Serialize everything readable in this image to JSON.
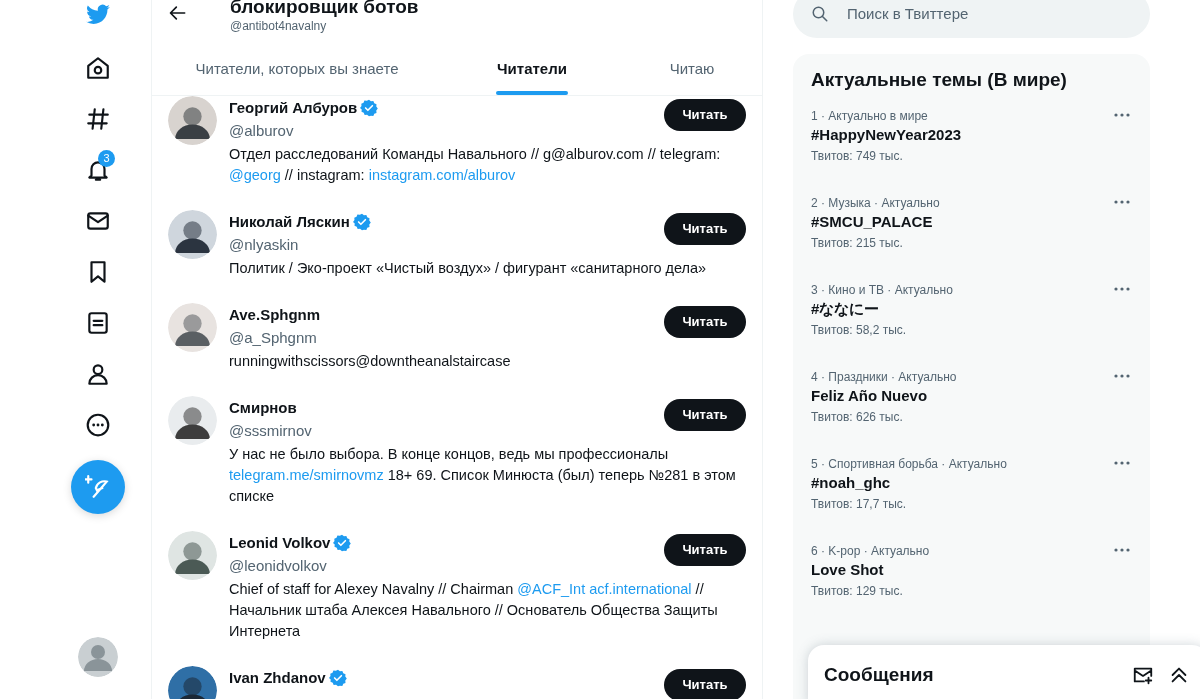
{
  "nav": {
    "notifications_badge": "3"
  },
  "profile": {
    "title": "блокировщик ботов",
    "handle": "@antibot4navalny"
  },
  "tabs": [
    {
      "label": "Читатели, которых вы знаете",
      "selected": false
    },
    {
      "label": "Читатели",
      "selected": true
    },
    {
      "label": "Читаю",
      "selected": false
    }
  ],
  "users": [
    {
      "name": "Георгий Албуров",
      "verified": true,
      "handle": "@alburov",
      "button": "Читать",
      "bio": [
        {
          "kind": "text",
          "text": "Отдел расследований Команды Навального // g@alburov.com // telegram: "
        },
        {
          "kind": "link",
          "text": "@georg"
        },
        {
          "kind": "text",
          "text": " // instagram: "
        },
        {
          "kind": "link",
          "text": "instagram.com/alburov"
        }
      ]
    },
    {
      "name": "Николай Ляскин",
      "verified": true,
      "handle": "@nlyaskin",
      "button": "Читать",
      "bio": [
        {
          "kind": "text",
          "text": "Политик / Эко-проект «Чистый воздух» / фигурант «санитарного дела»"
        }
      ]
    },
    {
      "name": "Ave.Sphgnm",
      "verified": false,
      "handle": "@a_Sphgnm",
      "button": "Читать",
      "bio": [
        {
          "kind": "text",
          "text": "runningwithscissors@downtheanalstaircase"
        }
      ]
    },
    {
      "name": "Смирнов",
      "verified": false,
      "handle": "@sssmirnov",
      "button": "Читать",
      "bio": [
        {
          "kind": "text",
          "text": "У нас не было выбора. В конце концов, ведь мы профессионалы "
        },
        {
          "kind": "link",
          "text": "telegram.me/smirnovmz"
        },
        {
          "kind": "text",
          "text": " 18+ 69. Список Минюста (был) теперь №281 в этом списке"
        }
      ]
    },
    {
      "name": "Leonid Volkov",
      "verified": true,
      "handle": "@leonidvolkov",
      "button": "Читать",
      "bio": [
        {
          "kind": "text",
          "text": "Chief of staff for Alexey Navalny // Chairman "
        },
        {
          "kind": "link",
          "text": "@ACF_Int acf.international"
        },
        {
          "kind": "text",
          "text": " // Начальник штаба Алексея Навального // Основатель Общества Защиты Интернета"
        }
      ]
    },
    {
      "name": "Ivan Zhdanov",
      "verified": true,
      "button": "Читать"
    }
  ],
  "search": {
    "placeholder": "Поиск в Твиттере"
  },
  "trends": {
    "title": "Актуальные темы (В мире)",
    "items": [
      {
        "meta": "1 · Актуально в мире",
        "topic": "#HappyNewYear2023",
        "count": "Твитов: 749 тыс."
      },
      {
        "meta": "2 · Музыка · Актуально",
        "topic": "#SMCU_PALACE",
        "count": "Твитов: 215 тыс."
      },
      {
        "meta": "3 · Кино и ТВ · Актуально",
        "topic": "#ななにー",
        "count": "Твитов: 58,2 тыс."
      },
      {
        "meta": "4 · Праздники · Актуально",
        "topic": "Feliz Año Nuevo",
        "count": "Твитов: 626 тыс."
      },
      {
        "meta": "5 · Спортивная борьба · Актуально",
        "topic": "#noah_ghc",
        "count": "Твитов: 17,7 тыс."
      },
      {
        "meta": "6 · K-pop · Актуально",
        "topic": "Love Shot",
        "count": "Твитов: 129 тыс."
      }
    ]
  },
  "messages": {
    "title": "Сообщения"
  }
}
